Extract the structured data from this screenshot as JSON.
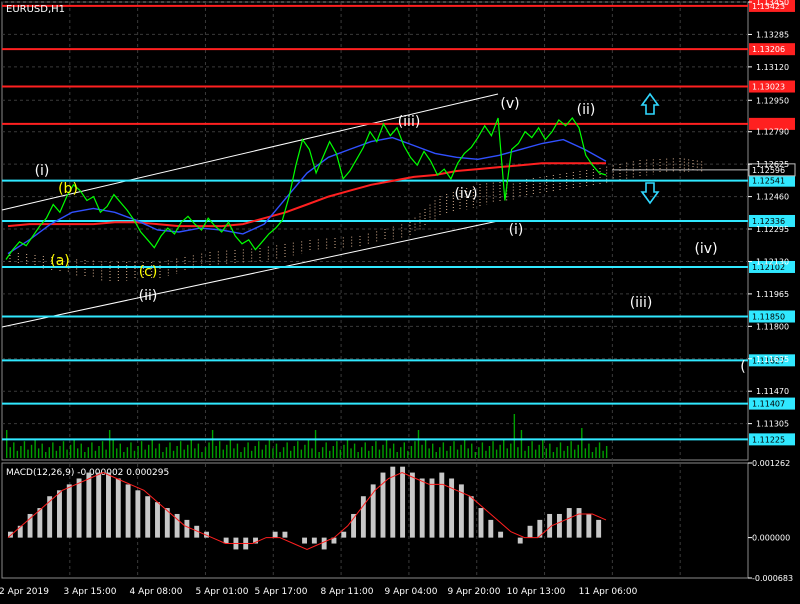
{
  "window": {
    "symbol_label": "EURUSD,H1",
    "background": "#000000",
    "grid_color": "#3a3a3a"
  },
  "chart_data": {
    "type": "line",
    "title": "EURUSD,H1",
    "x_ticks": [
      "2 Apr 2019",
      "3 Apr 15:00",
      "4 Apr 08:00",
      "5 Apr 01:00",
      "5 Apr 17:00",
      "8 Apr 11:00",
      "9 Apr 04:00",
      "9 Apr 20:00",
      "10 Apr 13:00",
      "11 Apr 06:00"
    ],
    "y_ticks": [
      "1.13450",
      "1.13285",
      "1.13120",
      "1.12950",
      "1.12790",
      "1.12625",
      "1.12460",
      "1.12295",
      "1.12130",
      "1.11965",
      "1.11800",
      "1.11635",
      "1.11470",
      "1.11305"
    ],
    "ylim": [
      1.1112,
      1.1345
    ],
    "price_series": {
      "name": "",
      "color": "#00ff00",
      "values": [
        1.1214,
        1.1219,
        1.1223,
        1.1221,
        1.1226,
        1.1231,
        1.1235,
        1.1242,
        1.1238,
        1.1246,
        1.1252,
        1.1249,
        1.1244,
        1.1246,
        1.1238,
        1.1241,
        1.1247,
        1.1243,
        1.1239,
        1.1234,
        1.1228,
        1.1224,
        1.122,
        1.1226,
        1.123,
        1.1227,
        1.1233,
        1.1236,
        1.1232,
        1.1229,
        1.1235,
        1.1231,
        1.1228,
        1.1233,
        1.1226,
        1.1222,
        1.1224,
        1.1219,
        1.1223,
        1.1227,
        1.123,
        1.1234,
        1.1246,
        1.1262,
        1.1275,
        1.127,
        1.1258,
        1.1266,
        1.1274,
        1.1268,
        1.1255,
        1.1259,
        1.1265,
        1.1271,
        1.1279,
        1.1274,
        1.1283,
        1.1277,
        1.1281,
        1.1272,
        1.1266,
        1.1262,
        1.1269,
        1.1264,
        1.1257,
        1.126,
        1.1255,
        1.1263,
        1.1268,
        1.1271,
        1.1276,
        1.1282,
        1.1277,
        1.1286,
        1.1244,
        1.127,
        1.1273,
        1.1279,
        1.1276,
        1.1281,
        1.1275,
        1.1279,
        1.1285,
        1.1282,
        1.1286,
        1.1281,
        1.1267,
        1.1262,
        1.1258,
        1.1257
      ]
    },
    "moving_averages": [
      {
        "name": "",
        "color": "#ff2020",
        "values": [
          1.1231,
          1.1232,
          1.1232,
          1.1232,
          1.1232,
          1.1233,
          1.1233,
          1.1232,
          1.1231,
          1.1231,
          1.1231,
          1.1232,
          1.1235,
          1.1238,
          1.1242,
          1.1246,
          1.1249,
          1.1252,
          1.1254,
          1.1256,
          1.1257,
          1.1259,
          1.126,
          1.1261,
          1.1262,
          1.1263,
          1.1263,
          1.1263,
          1.1263
        ]
      },
      {
        "name": "",
        "color": "#3050ff",
        "values": [
          1.1217,
          1.1224,
          1.1232,
          1.1238,
          1.124,
          1.1238,
          1.1234,
          1.1229,
          1.1228,
          1.123,
          1.1229,
          1.1227,
          1.1232,
          1.1245,
          1.1258,
          1.1266,
          1.127,
          1.1274,
          1.1276,
          1.1272,
          1.1268,
          1.1266,
          1.1265,
          1.1267,
          1.127,
          1.1273,
          1.1275,
          1.127,
          1.1264
        ]
      }
    ],
    "level_lines": {
      "red": [
        {
          "price": 1.1343,
          "label": "1.13423"
        },
        {
          "price": 1.1321,
          "label": "1.13206"
        },
        {
          "price": 1.1302,
          "label": "1.13023"
        },
        {
          "price": 1.1283,
          "label": ""
        }
      ],
      "cyan": [
        {
          "price": 1.12541,
          "label": "1.12541"
        },
        {
          "price": 1.12336,
          "label": "1.12336"
        },
        {
          "price": 1.12102,
          "label": "1.12102"
        },
        {
          "price": 1.1185,
          "label": "1.11850"
        },
        {
          "price": 1.11627,
          "label": "1.11627"
        },
        {
          "price": 1.11407,
          "label": "1.11407"
        },
        {
          "price": 1.11225,
          "label": "1.11225"
        }
      ],
      "current": {
        "price": 1.12596,
        "label": "1.12596"
      }
    },
    "wave_labels": [
      {
        "text": "(i)",
        "color": "#ffffff"
      },
      {
        "text": "(b)",
        "color": "#ffff00"
      },
      {
        "text": "(a)",
        "color": "#ffff00"
      },
      {
        "text": "(c)",
        "color": "#ffff00"
      },
      {
        "text": "(ii)",
        "color": "#ffffff"
      },
      {
        "text": "(iii)",
        "color": "#ffffff"
      },
      {
        "text": "(v)",
        "color": "#ffffff"
      },
      {
        "text": "(iv)",
        "color": "#ffffff"
      },
      {
        "text": "(ii)",
        "color": "#ffffff"
      },
      {
        "text": "(i)",
        "color": "#ffffff"
      },
      {
        "text": "(iv)",
        "color": "#ffffff"
      },
      {
        "text": "(iii)",
        "color": "#ffffff"
      },
      {
        "text": "(",
        "color": "#ffffff"
      }
    ],
    "arrows": [
      {
        "direction": "up",
        "color": "#30d8ff"
      },
      {
        "direction": "down",
        "color": "#30d8ff"
      }
    ],
    "macd": {
      "label": "MACD(12,26,9) -0.000002 0.000295",
      "y_ticks": [
        "0.001262",
        "0.000000",
        "-0.000683"
      ],
      "ylim": [
        -0.000683,
        0.001262
      ],
      "histogram": [
        0.0001,
        0.0002,
        0.0004,
        0.0005,
        0.0007,
        0.0008,
        0.0009,
        0.001,
        0.0011,
        0.0011,
        0.0011,
        0.001,
        0.0009,
        0.0008,
        0.0007,
        0.0006,
        0.0005,
        0.0004,
        0.0003,
        0.0002,
        0.0001,
        0.0,
        -0.0001,
        -0.0002,
        -0.0002,
        -0.0001,
        0.0,
        0.0001,
        0.0001,
        0.0,
        -0.0001,
        -0.0001,
        -0.0002,
        -0.0001,
        0.0001,
        0.0004,
        0.0007,
        0.0009,
        0.0011,
        0.0012,
        0.0012,
        0.0011,
        0.001,
        0.001,
        0.0011,
        0.001,
        0.0009,
        0.0007,
        0.0005,
        0.0003,
        0.0001,
        0.0,
        -0.0001,
        0.0002,
        0.0003,
        0.0004,
        0.0004,
        0.0005,
        0.0005,
        0.0004,
        0.0003
      ],
      "signal": [
        0.0,
        0.0002,
        0.0004,
        0.0006,
        0.0008,
        0.0009,
        0.001,
        0.0011,
        0.001,
        0.0009,
        0.0008,
        0.0006,
        0.0004,
        0.0002,
        0.0001,
        0.0,
        -0.0001,
        -0.0001,
        -0.0001,
        0.0,
        0.0,
        -0.0001,
        -0.0002,
        -0.0001,
        0.0,
        0.0002,
        0.0005,
        0.0008,
        0.001,
        0.0011,
        0.001,
        0.0009,
        0.0009,
        0.0008,
        0.0007,
        0.0005,
        0.0003,
        0.0001,
        0.0,
        0.0,
        0.0002,
        0.0003,
        0.0004,
        0.0004,
        0.0003
      ]
    }
  }
}
